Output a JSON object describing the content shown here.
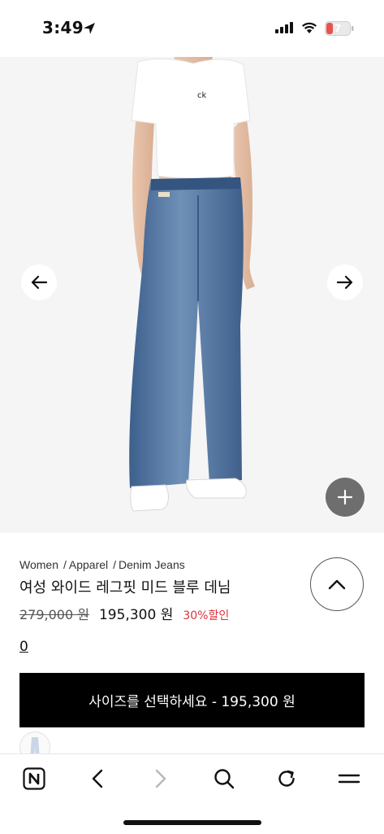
{
  "status_bar": {
    "time": "3:49",
    "battery_level": "7",
    "battery_color": "#e5534b"
  },
  "product": {
    "breadcrumb": [
      "Women",
      "Apparel",
      "Denim Jeans"
    ],
    "breadcrumb_separator": "/",
    "title": "여성 와이드 레그핏 미드 블루 데님",
    "original_price": "279,000 원",
    "sale_price": "195,300 원",
    "discount": "30%할인",
    "review_count": "0",
    "discount_color": "#d9333a"
  },
  "cta": {
    "label": "사이즈를 선택하세요 - 195,300 원"
  },
  "icons": {
    "hero_prev": "arrow-left-icon",
    "hero_next": "arrow-right-icon",
    "zoom": "plus-icon",
    "collapse": "chevron-up-icon",
    "toolbar": [
      "n-logo-icon",
      "back-icon",
      "forward-icon",
      "search-icon",
      "reload-icon",
      "menu-icon"
    ]
  }
}
